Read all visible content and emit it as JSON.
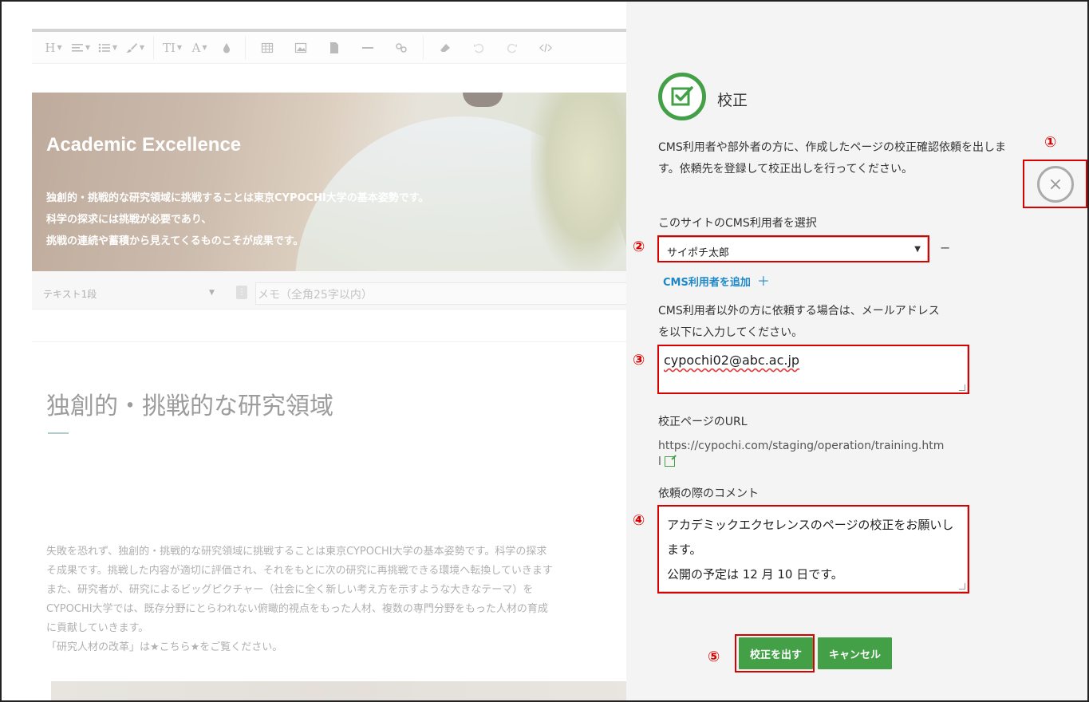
{
  "editor": {
    "toolbar": {
      "heading_label": "H",
      "text_size_label": "TI",
      "font_color_label": "A",
      "items": [
        "heading",
        "align",
        "list",
        "brush",
        "text-size",
        "font-color",
        "fill",
        "table",
        "image",
        "file",
        "hr",
        "link",
        "eraser",
        "undo",
        "redo",
        "source"
      ]
    },
    "hero": {
      "title": "Academic Excellence",
      "line1": "独創的・挑戦的な研究領域に挑戦することは東京CYPOCHI大学の基本姿勢です。",
      "line2": "科学の探求には挑戦が必要であり、",
      "line3": "挑戦の連続や蓄積から見えてくるものこそが成果です。"
    },
    "segment": {
      "type_value": "テキスト1段",
      "memo_placeholder": "メモ（全角25字以内）"
    },
    "heading": "独創的・挑戦的な研究領域",
    "body": [
      "失敗を恐れず、独創的・挑戦的な研究領域に挑戦することは東京CYPOCHI大学の基本姿勢です。科学の探求",
      "そ成果です。挑戦した内容が適切に評価され、それをもとに次の研究に再挑戦できる環境へ転換していきます",
      "また、研究者が、研究によるビッグピクチャー（社会に全く新しい考え方を示すような大きなテーマ）を",
      "CYPOCHI大学では、既存分野にとらわれない俯瞰的視点をもった人材、複数の専門分野をもった人材の育成",
      "に貢献していきます。",
      "「研究人材の改革」は★こちら★をご覧ください。"
    ]
  },
  "panel": {
    "title": "校正",
    "description": "CMS利用者や部外者の方に、作成したページの校正確認依頼を出します。依頼先を登録して校正出しを行ってください。",
    "cms_user_label": "このサイトのCMS利用者を選択",
    "cms_user_value": "サイポチ太郎",
    "remove_label": "−",
    "add_user_label": "CMS利用者を追加",
    "add_user_plus": "＋",
    "external_label_1": "CMS利用者以外の方に依頼する場合は、メールアドレス",
    "external_label_2": "を以下に入力してください。",
    "email_value": "cypochi02@abc.ac.jp",
    "url_label": "校正ページのURL",
    "url_value": "https://cypochi.com/staging/operation/training.html",
    "comment_label": "依頼の際のコメント",
    "comment_value": "アカデミックエクセレンスのページの校正をお願いします。\n公開の予定は 12 月 10 日です。",
    "submit_label": "校正を出す",
    "cancel_label": "キャンセル",
    "close_symbol": "×"
  },
  "annotations": {
    "n1": "①",
    "n2": "②",
    "n3": "③",
    "n4": "④",
    "n5": "⑤",
    "color": "#d90000"
  },
  "colors": {
    "accent_green": "#43a047",
    "link_blue": "#1e88c7",
    "panel_bg": "#f4f4f4"
  }
}
